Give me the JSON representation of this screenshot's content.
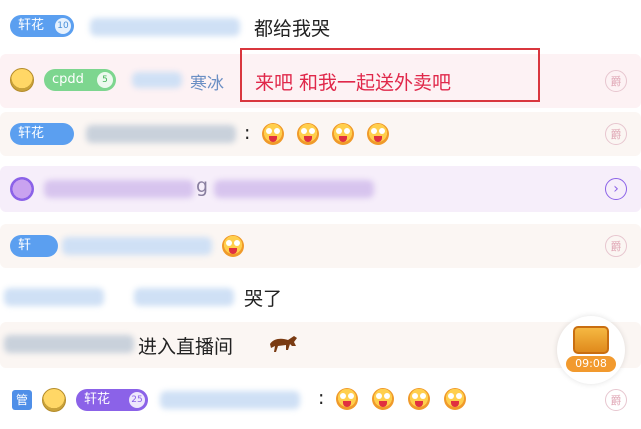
{
  "rows": [
    {
      "badge": {
        "label": "轩花",
        "level": "10"
      },
      "message": "都给我哭"
    },
    {
      "badge": {
        "label": "cpdd",
        "level": "5"
      },
      "username": "寒冰",
      "colon": ":",
      "message": "来吧 和我一起送外卖吧"
    },
    {
      "badge": {
        "label": "轩花",
        "level": ""
      },
      "colon": ":"
    },
    {
      "text": "g"
    },
    {
      "badge": {
        "label": "轩",
        "level": ""
      }
    },
    {
      "message": "哭了"
    },
    {
      "message": "进入直播间",
      "icon": "horse-icon"
    },
    {
      "tag": "管",
      "badge": {
        "label": "轩花",
        "level": "25"
      },
      "colon": ":"
    }
  ],
  "treasure": {
    "timer": "09:08"
  },
  "icons": {
    "side_badge": "爵",
    "arrow": "›"
  },
  "colors": {
    "highlight_border": "#d9363e",
    "message_red": "#e0284a",
    "badge_blue": "#5b9ff0",
    "badge_green": "#7dd68f",
    "badge_purple": "#8b62e8"
  }
}
